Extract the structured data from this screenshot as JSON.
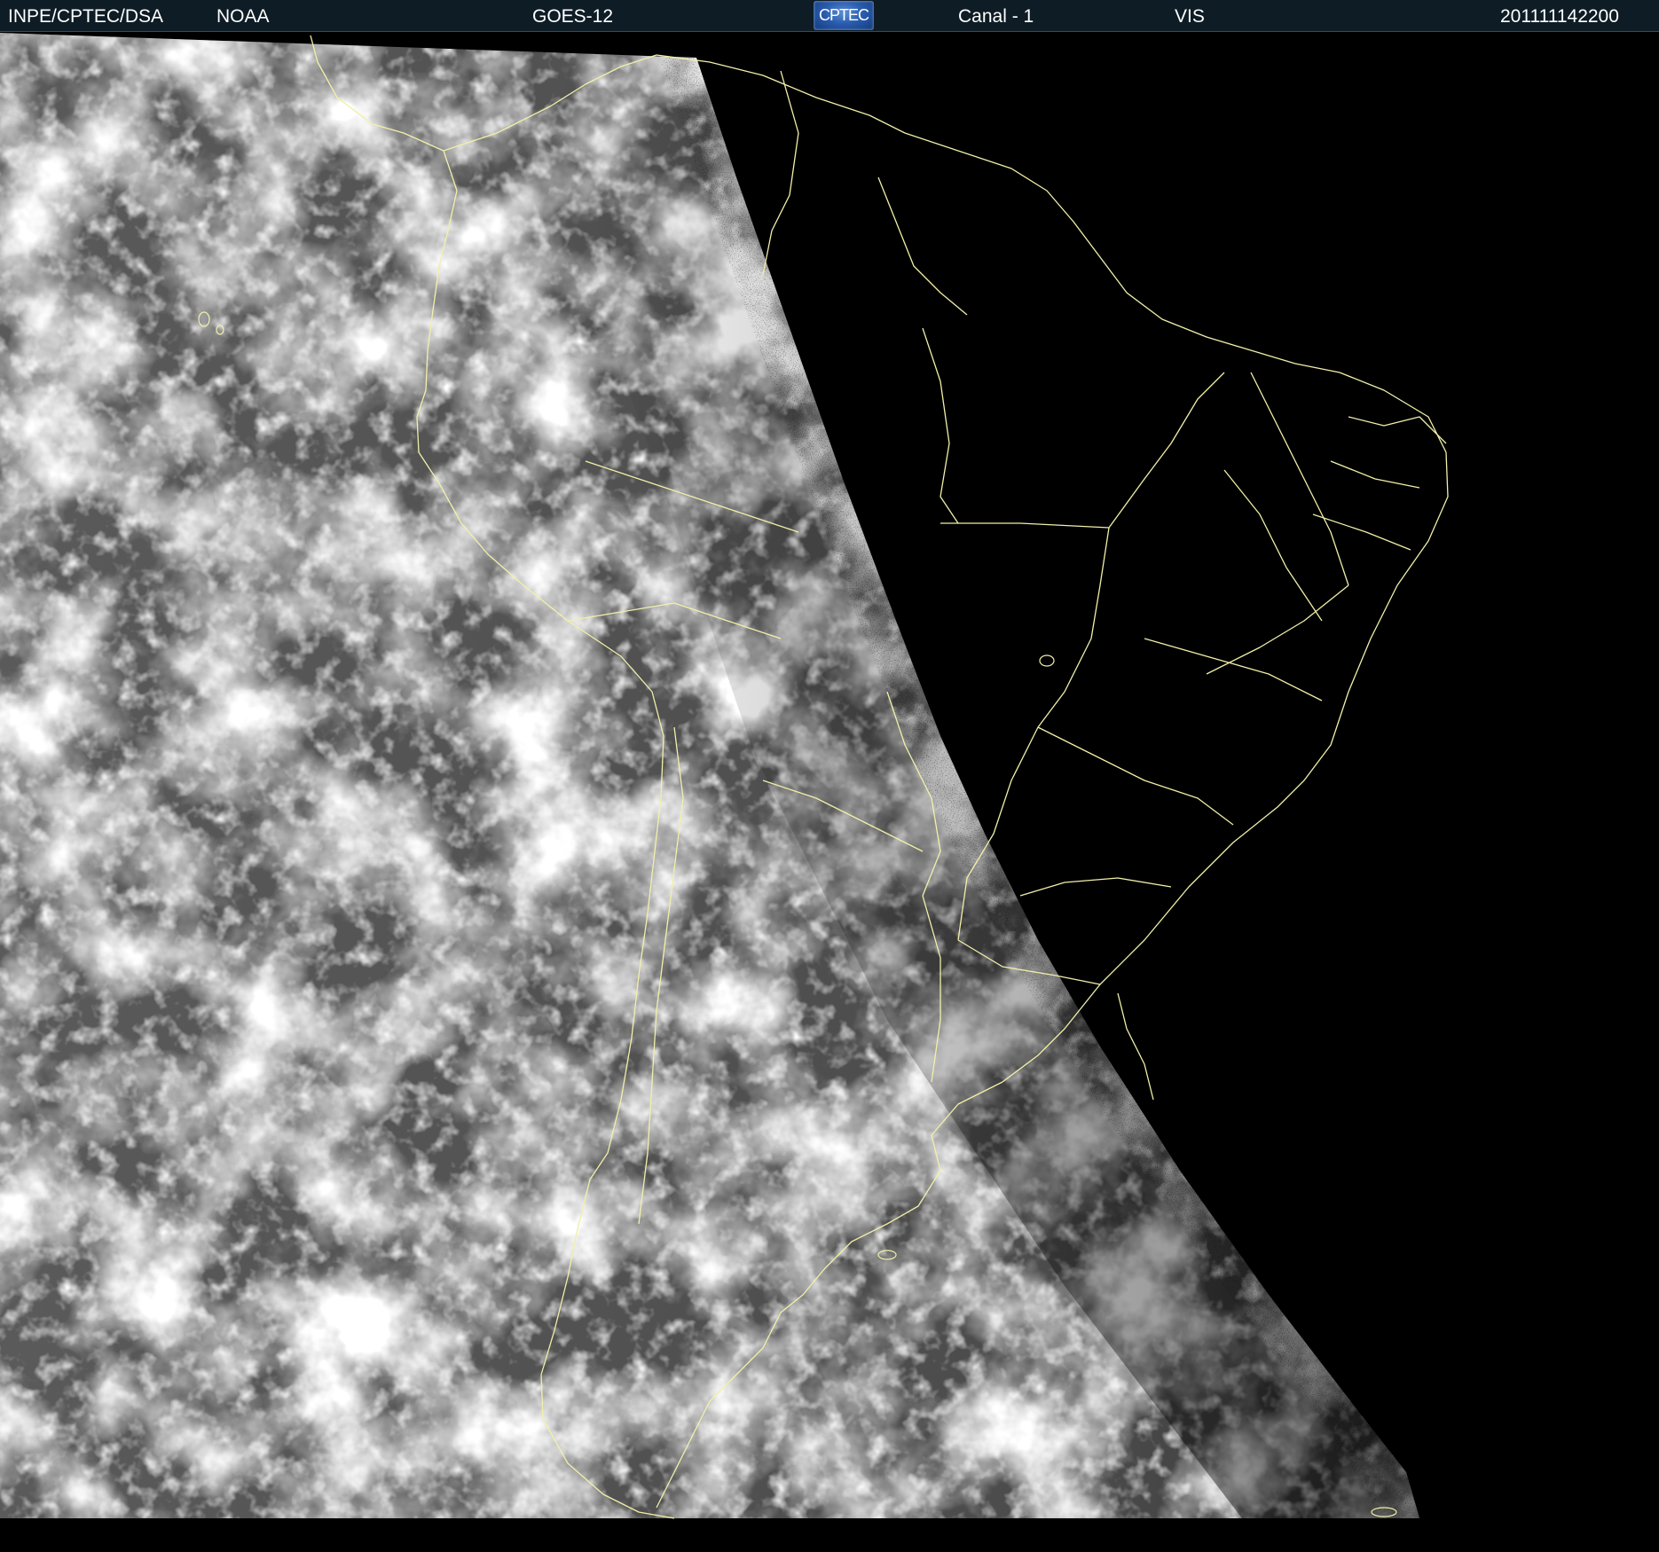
{
  "header": {
    "agency": "INPE/CPTEC/DSA",
    "source": "NOAA",
    "satellite": "GOES-12",
    "logo_text": "CPTEC",
    "channel": "Canal - 1",
    "band": "VIS",
    "timestamp": "201111142200"
  },
  "colors": {
    "header_bg": "#0e1c25",
    "header_text": "#ffffff",
    "map_lines": "#f2f0a8",
    "night_side": "#000000",
    "day_side_base": "#525252"
  },
  "icons": {
    "logo": "cptec-logo"
  }
}
